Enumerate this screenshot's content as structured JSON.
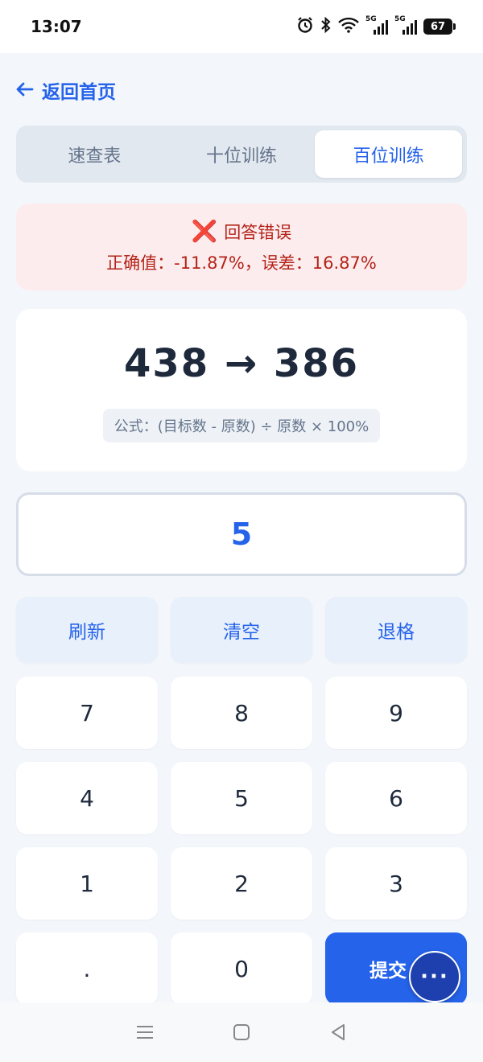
{
  "status": {
    "time": "13:07",
    "battery": "67",
    "network_1": "5G",
    "network_2": "5G",
    "icons": [
      "alarm-icon",
      "bluetooth-icon",
      "wifi-icon",
      "signal-icon",
      "signal-icon",
      "battery-icon"
    ]
  },
  "header": {
    "back_label": "返回首页"
  },
  "tabs": [
    {
      "label": "速查表",
      "active": false
    },
    {
      "label": "十位训练",
      "active": false
    },
    {
      "label": "百位训练",
      "active": true
    }
  ],
  "alert": {
    "icon": "❌",
    "title": "回答错误",
    "detail": "正确值：-11.87%，误差：16.87%"
  },
  "question": {
    "text": "438 → 386",
    "formula": "公式：(目标数 - 原数) ÷ 原数 × 100%"
  },
  "answer": {
    "value": "5"
  },
  "keypad": {
    "refresh": "刷新",
    "clear": "清空",
    "backspace": "退格",
    "digits": [
      "7",
      "8",
      "9",
      "4",
      "5",
      "6",
      "1",
      "2",
      "3",
      ".",
      "0"
    ],
    "submit": "提交"
  },
  "fab": {
    "label": "···"
  },
  "colors": {
    "accent": "#2563eb",
    "error_bg": "#fdecee",
    "error_text": "#b42318",
    "background": "#f3f6fb"
  }
}
